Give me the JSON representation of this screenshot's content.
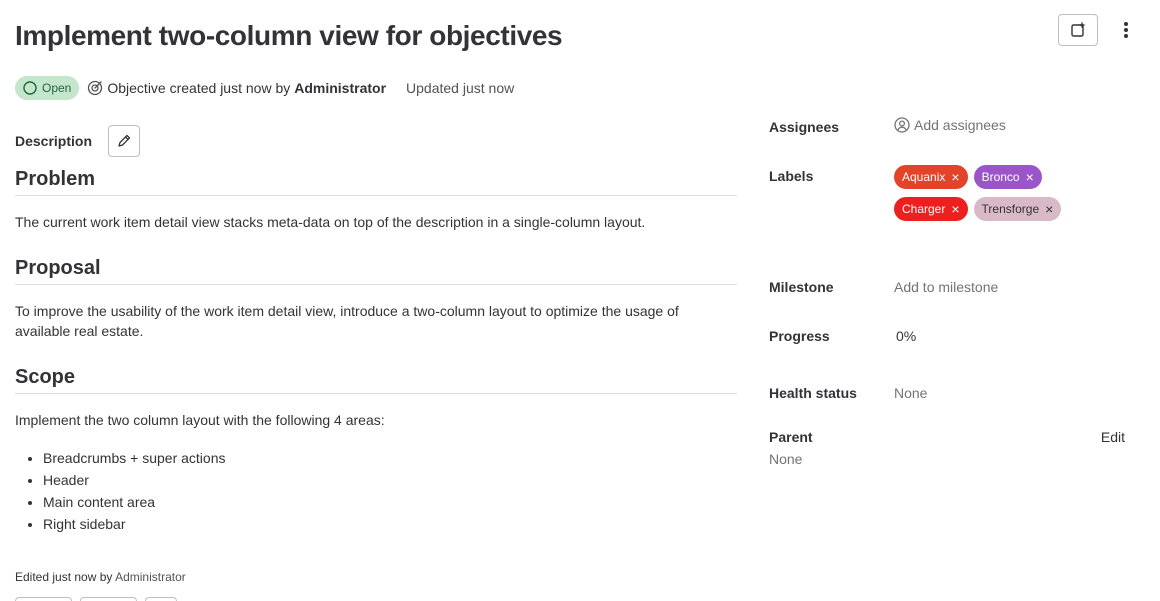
{
  "header": {
    "title": "Implement two-column view for objectives",
    "status": "Open",
    "created_text": "Objective created just now by",
    "author": "Administrator",
    "updated": "Updated just now"
  },
  "description": {
    "label": "Description",
    "sections": [
      {
        "heading": "Problem",
        "text": "The current work item detail view stacks meta-data on top of the description in a single-column layout."
      },
      {
        "heading": "Proposal",
        "text": "To improve the usability of the work item detail view, introduce a two-column layout to optimize the usage of available real estate."
      },
      {
        "heading": "Scope",
        "text": "Implement the two column layout with the following 4 areas:",
        "bullets": [
          "Breadcrumbs + super actions",
          "Header",
          "Main content area",
          "Right sidebar"
        ]
      }
    ],
    "edited_prefix": "Edited just now by",
    "edited_by": "Administrator"
  },
  "sidebar": {
    "assignees": {
      "label": "Assignees",
      "action": "Add assignees"
    },
    "labels": {
      "label": "Labels",
      "items": [
        {
          "name": "Aquanix",
          "bg": "#e24329",
          "fg": "#ffffff"
        },
        {
          "name": "Bronco",
          "bg": "#9a56c8",
          "fg": "#ffffff"
        },
        {
          "name": "Charger",
          "bg": "#ee1f1f",
          "fg": "#ffffff"
        },
        {
          "name": "Trensforge",
          "bg": "#d9b9c7",
          "fg": "#333238"
        }
      ]
    },
    "milestone": {
      "label": "Milestone",
      "value": "Add to milestone"
    },
    "progress": {
      "label": "Progress",
      "value": "0",
      "unit": "%"
    },
    "health": {
      "label": "Health status",
      "value": "None"
    },
    "parent": {
      "label": "Parent",
      "edit": "Edit",
      "value": "None"
    }
  },
  "colors": {
    "open_bg": "#c3e6cd",
    "open_fg": "#24663b",
    "text": "#333238",
    "muted": "#737278",
    "border": "#dcdcde"
  },
  "icons": [
    "todo-add-icon",
    "ellipsis-vertical-icon",
    "status-open-icon",
    "work-item-objective-icon",
    "pencil-icon",
    "user-icon",
    "close-icon"
  ]
}
